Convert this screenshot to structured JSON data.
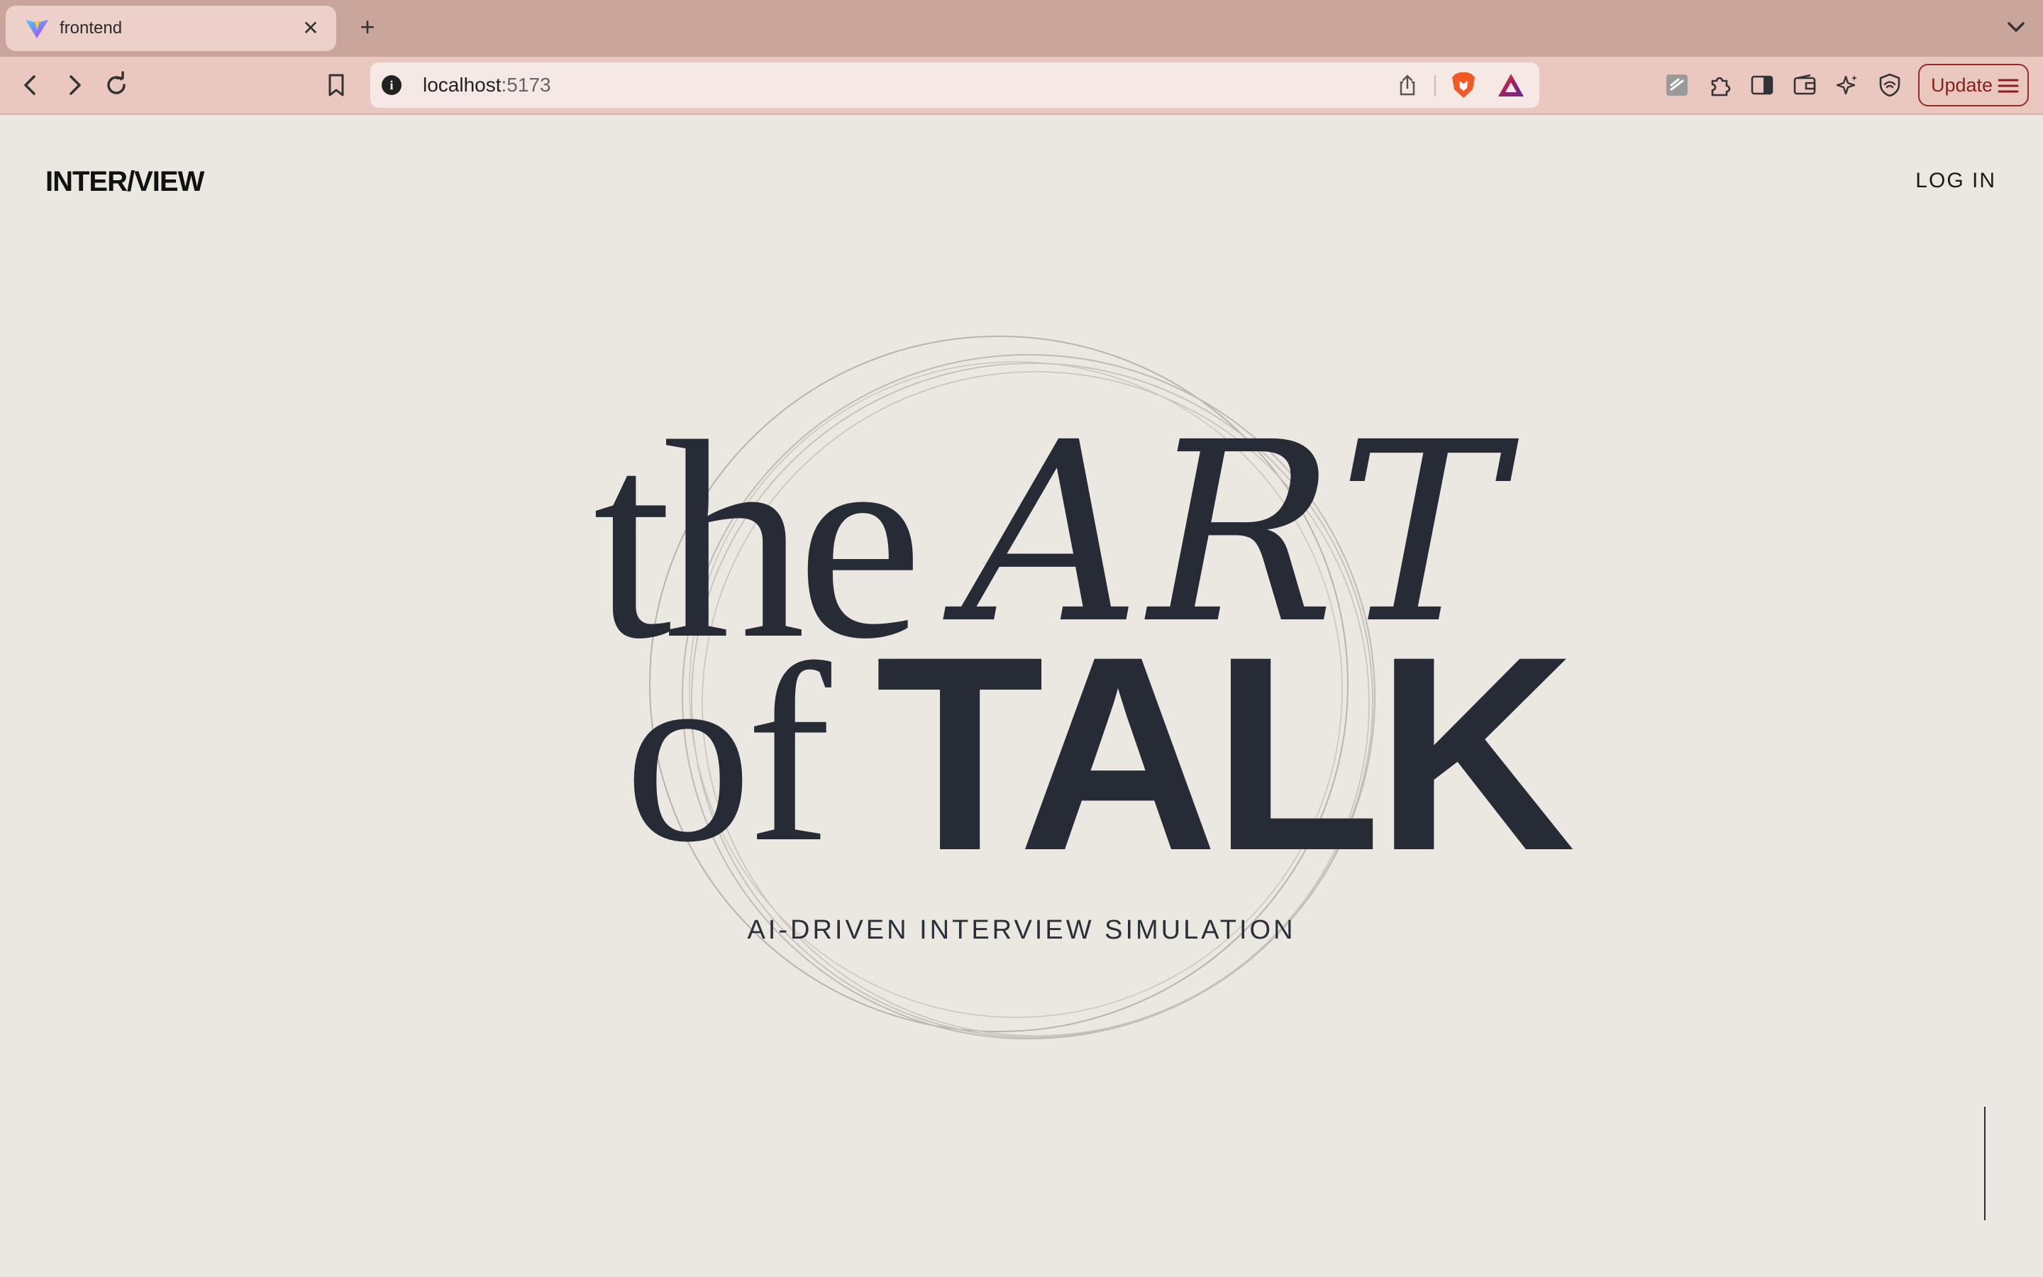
{
  "browser": {
    "tab": {
      "title": "frontend",
      "close_glyph": "✕",
      "favicon": "vite-logo-icon"
    },
    "new_tab_glyph": "+",
    "url": {
      "host": "localhost",
      "port": ":5173"
    },
    "update_label": "Update"
  },
  "page": {
    "brand": "INTER/VIEW",
    "login": "LOG IN",
    "hero": {
      "word_the": "the",
      "word_art": "ART",
      "word_of": "of",
      "word_talk": "TALK"
    },
    "tagline": "AI-DRIVEN INTERVIEW SIMULATION"
  },
  "colors": {
    "background": "#ebe8e2",
    "text": "#262b36",
    "tabbar": "#c9a59b",
    "toolbar": "#eac8c0",
    "update_accent": "#9a2a2a"
  }
}
